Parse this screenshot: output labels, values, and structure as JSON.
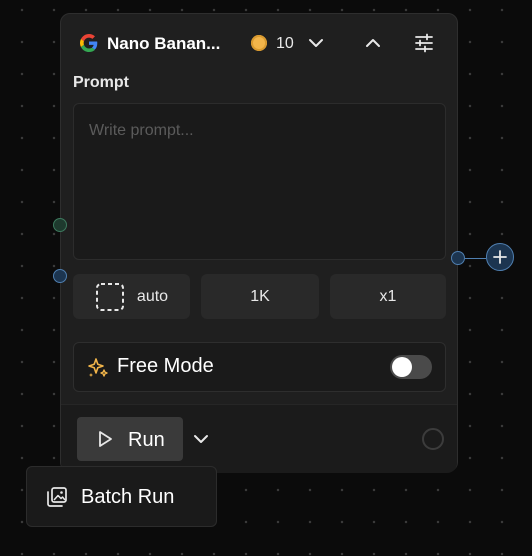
{
  "node": {
    "title": "Nano Banan...",
    "credits": "10",
    "icons": {
      "logo": "google-logo-icon",
      "credits": "coin-icon",
      "credits_menu": "chevron-down-icon",
      "collapse": "chevron-up-icon",
      "settings": "sliders-icon"
    },
    "prompt": {
      "label": "Prompt",
      "value": "",
      "placeholder": "Write prompt..."
    },
    "options": {
      "aspect": {
        "label": "auto",
        "icon": "aspect-ratio-icon"
      },
      "resolution": {
        "label": "1K"
      },
      "count": {
        "label": "x1"
      }
    },
    "free_mode": {
      "label": "Free Mode",
      "icon": "sparkles-icon",
      "enabled": false
    },
    "run": {
      "label": "Run",
      "icon": "play-icon",
      "dropdown_icon": "chevron-down-icon"
    }
  },
  "batch_menu": {
    "label": "Batch Run",
    "icon": "image-stack-icon"
  },
  "ports": {
    "output_add_icon": "plus-icon"
  },
  "colors": {
    "canvas": "#0b0b0b",
    "node_bg": "#1f1f1f",
    "coin": "#f2b54a",
    "sparkle": "#f2b54a",
    "port_green": "#1e3a2e",
    "port_blue": "#1c3550",
    "port_blue_border": "#4f7fb0"
  }
}
